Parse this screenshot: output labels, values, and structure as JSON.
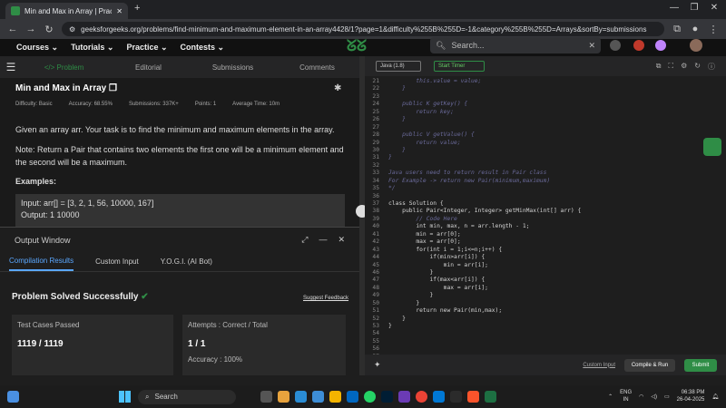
{
  "browser": {
    "tab_title": "Min and Max in Array | Practice",
    "new_tab": "+",
    "url": "geeksforgeeks.org/problems/find-minimum-and-maximum-element-in-an-array4428/1?page=1&difficulty%255B%255D=-1&category%255B%255D=Arrays&sortBy=submissions"
  },
  "site": {
    "nav": [
      "Courses ⌄",
      "Tutorials ⌄",
      "Practice ⌄",
      "Contests ⌄"
    ],
    "search_placeholder": "Search...",
    "brand_color": "#2f8d46"
  },
  "problem": {
    "tabs": [
      "</> Problem",
      "Editorial",
      "Submissions",
      "Comments"
    ],
    "title": "Min and Max in Array",
    "meta": {
      "difficulty": "Difficulty: Basic",
      "accuracy": "Accuracy: 68.55%",
      "submissions": "Submissions: 337K+",
      "points": "Points: 1",
      "avg_time": "Average Time: 10m"
    },
    "statement": "Given an array arr. Your task is to find the minimum and maximum elements in the array.",
    "note": "Note: Return a Pair that contains two elements the first one will be a minimum element and the second will be a maximum.",
    "examples_heading": "Examples:",
    "example_input": "Input:  arr[] = [3, 2, 1, 56, 10000, 167]",
    "example_output": "Output:  1  10000"
  },
  "output_window": {
    "title": "Output Window",
    "tabs": [
      "Compilation Results",
      "Custom Input",
      "Y.O.G.I. (AI Bot)"
    ],
    "status": "Problem Solved Successfully",
    "feedback": "Suggest Feedback",
    "test_cases_label": "Test Cases Passed",
    "test_cases_value": "1119 / 1119",
    "attempts_label": "Attempts : Correct / Total",
    "attempts_value": "1 / 1",
    "accuracy_text": "Accuracy : 100%"
  },
  "editor": {
    "language": "Java (1.8)",
    "timer": "Start Timer",
    "lines": [
      {
        "n": "21",
        "t": "        this.value = value;",
        "c": true
      },
      {
        "n": "22",
        "t": "    }",
        "c": true
      },
      {
        "n": "23",
        "t": "",
        "c": true
      },
      {
        "n": "24",
        "t": "    public K getKey() {",
        "c": true
      },
      {
        "n": "25",
        "t": "        return key;",
        "c": true
      },
      {
        "n": "26",
        "t": "    }",
        "c": true
      },
      {
        "n": "27",
        "t": "",
        "c": true
      },
      {
        "n": "28",
        "t": "    public V getValue() {",
        "c": true
      },
      {
        "n": "29",
        "t": "        return value;",
        "c": true
      },
      {
        "n": "30",
        "t": "    }",
        "c": true
      },
      {
        "n": "31",
        "t": "}",
        "c": true
      },
      {
        "n": "32",
        "t": "",
        "c": false
      },
      {
        "n": "33",
        "t": "Java users need to return result in Pair class",
        "c": true
      },
      {
        "n": "34",
        "t": "For Example -> return new Pair(minimum,maximum)",
        "c": true
      },
      {
        "n": "35",
        "t": "*/",
        "c": true
      },
      {
        "n": "36",
        "t": "",
        "c": false
      },
      {
        "n": "37",
        "t": "class Solution {",
        "c": false
      },
      {
        "n": "38",
        "t": "    public Pair<Integer, Integer> getMinMax(int[] arr) {",
        "c": false
      },
      {
        "n": "39",
        "t": "        // Code Here",
        "c": true
      },
      {
        "n": "40",
        "t": "        int min, max, n = arr.length - 1;",
        "c": false
      },
      {
        "n": "41",
        "t": "        min = arr[0];",
        "c": false
      },
      {
        "n": "42",
        "t": "        max = arr[0];",
        "c": false
      },
      {
        "n": "43",
        "t": "        for(int i = 1;i<=n;i++) {",
        "c": false
      },
      {
        "n": "44",
        "t": "            if(min>arr[i]) {",
        "c": false
      },
      {
        "n": "45",
        "t": "                min = arr[i];",
        "c": false
      },
      {
        "n": "46",
        "t": "            }",
        "c": false
      },
      {
        "n": "47",
        "t": "            if(max<arr[i]) {",
        "c": false
      },
      {
        "n": "48",
        "t": "                max = arr[i];",
        "c": false
      },
      {
        "n": "49",
        "t": "            }",
        "c": false
      },
      {
        "n": "50",
        "t": "        }",
        "c": false
      },
      {
        "n": "51",
        "t": "        return new Pair(min,max);",
        "c": false
      },
      {
        "n": "52",
        "t": "    }",
        "c": false
      },
      {
        "n": "53",
        "t": "}",
        "c": false
      },
      {
        "n": "54",
        "t": "",
        "c": false
      },
      {
        "n": "55",
        "t": "",
        "c": false
      },
      {
        "n": "56",
        "t": "",
        "c": false
      },
      {
        "n": "57",
        "t": "",
        "c": false
      }
    ],
    "custom_input": "Custom Input",
    "compile_run": "Compile & Run",
    "submit": "Submit"
  },
  "taskbar": {
    "search": "Search",
    "lang": "ENG",
    "region": "IN",
    "time": "06:38 PM",
    "date": "26-04-2025"
  }
}
